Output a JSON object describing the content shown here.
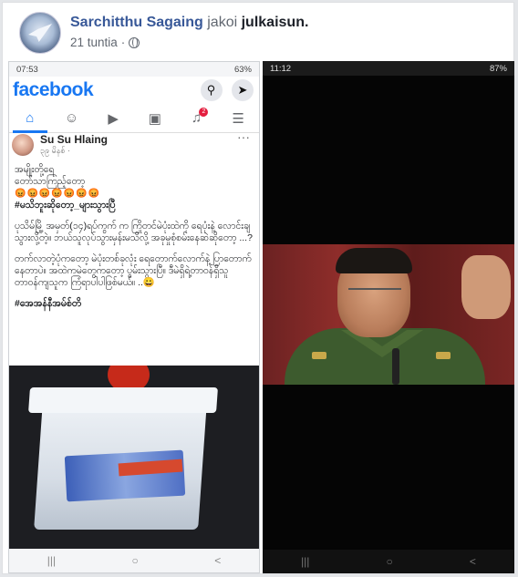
{
  "post": {
    "author": "Sarchitthu Sagaing",
    "verb": "jakoi",
    "object": "julkaisun.",
    "time": "21 tuntia",
    "separator": "·"
  },
  "left_phone": {
    "status": {
      "time": "07:53",
      "battery": "63%"
    },
    "app_name": "facebook",
    "notification_count": "2",
    "inner_post": {
      "author": "Su Su Hlaing",
      "time": "၃၉ မိနစ် · ",
      "line1": "အမျိုးတို့ရေ",
      "line2": "တော်သာကြည့်တော့",
      "emojis": "😡😡😡😡😡😡😡",
      "hashtag1": "#မသိဘူးဆိုတော့_များသွားပြီ",
      "para1": "ပုသိမ်မြို့ အမှတ်(၁၄)ရပ်ကွက် က ကြိုတင်မဲပုံးထဲကို ရေပုံးနဲ့ လောင်းချသွားလို့တဲ့။ ဘယ်သူလုပ်သွားမှန်းမသိလို့ အခုမှုစုံစမ်းနေဆဲဆိုတော့ ...?",
      "para2": "တက်လာတဲ့ပုံကတော့ မဲပုံးတစ်ခုလုံး ရေတောက်လောက်နဲ့ ပြာတောက်နေတာပဲ။ အထဲကမဲတွေကတော့ ပွမ်းသွားပြီ။ ဒီမဲရှိရဲ့တာဝန်ရှိသူ တာဝန်ကျသူက ကြံရာပါပါဖြစ်မယ်။ ..😀",
      "hashtag2": "#အေအန်နီအမ်စ်တိ"
    },
    "nav_buttons": [
      "|||",
      "○",
      "<"
    ]
  },
  "right_phone": {
    "status": {
      "time": "11:12",
      "battery": "87%"
    },
    "nav_buttons": [
      "|||",
      "○",
      "<"
    ]
  },
  "icons": [
    "globe-icon",
    "search-icon",
    "messenger-icon",
    "home-icon",
    "friends-icon",
    "watch-icon",
    "marketplace-icon",
    "bell-icon",
    "menu-icon"
  ]
}
